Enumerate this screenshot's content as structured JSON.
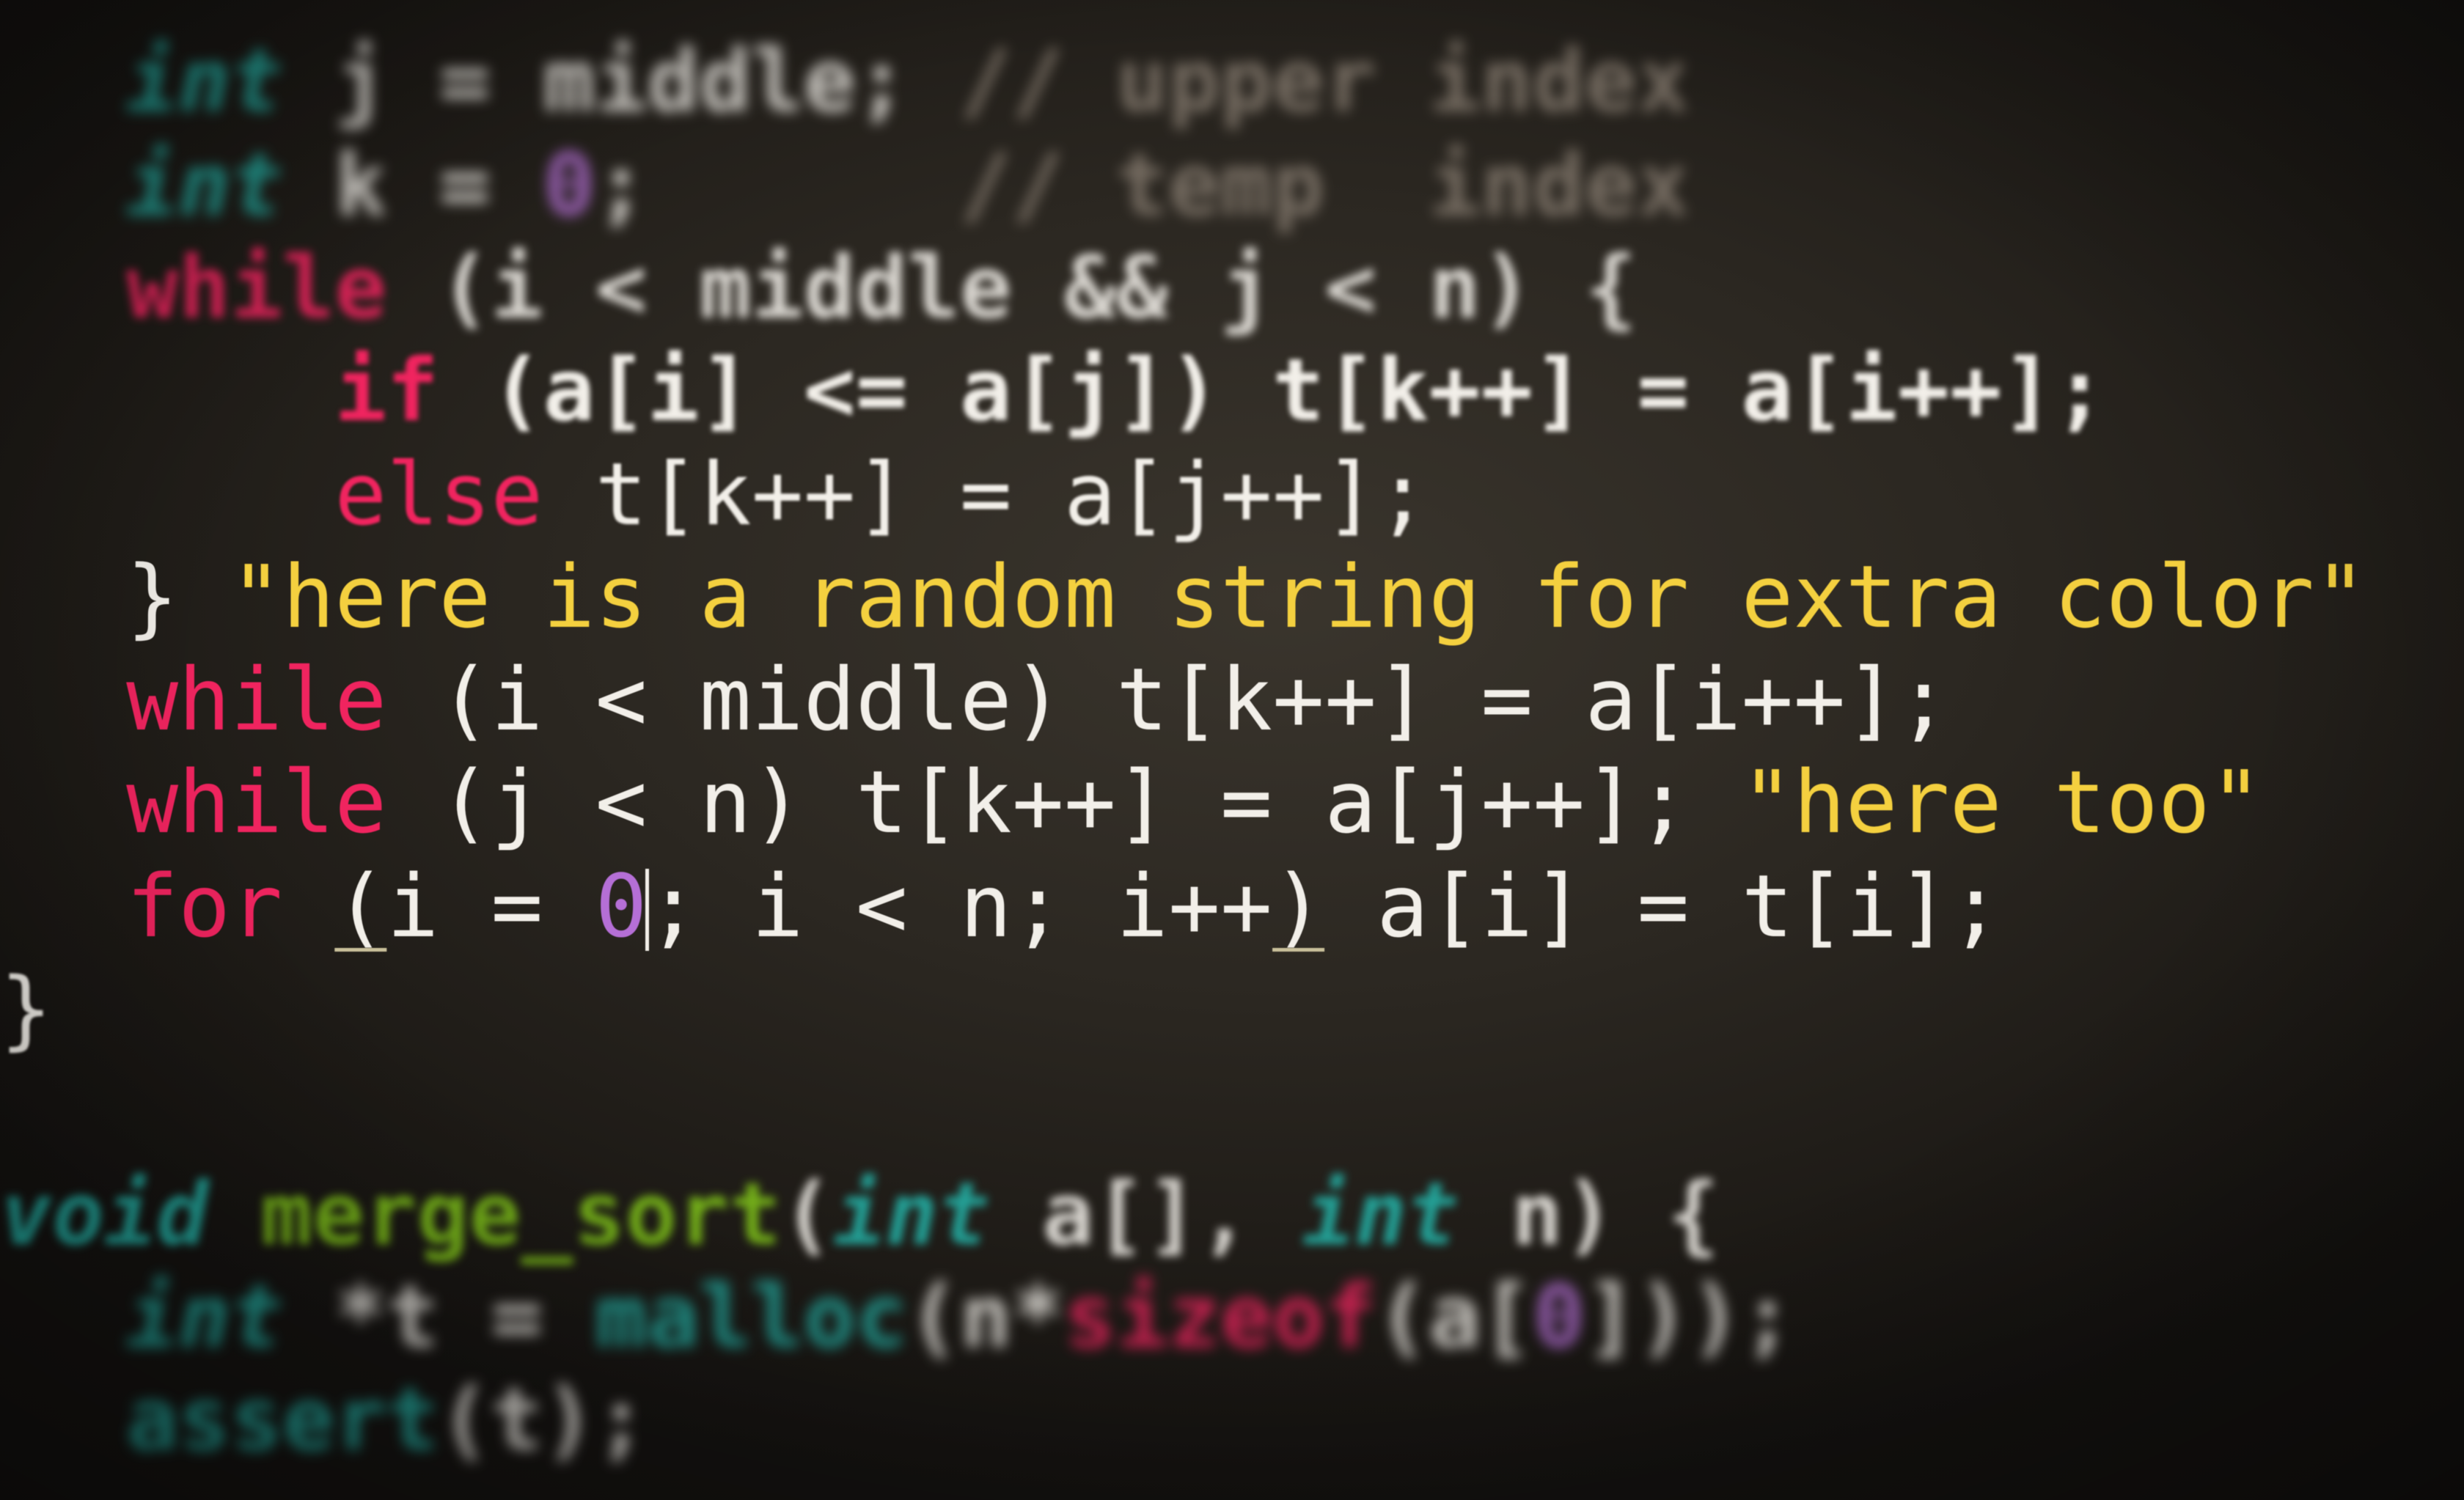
{
  "colors": {
    "background": "#2b2721",
    "keyword": "#f0245f",
    "type": "#24b3a8",
    "string": "#f4d03f",
    "number": "#b56fd6",
    "plain": "#f2efe9",
    "comment": "#8a7f73",
    "function": "#7fc21a",
    "cursor": "#f2efe9"
  },
  "code_lines": [
    {
      "tokens": [
        {
          "text": "  ",
          "color": "plain"
        },
        {
          "text": "int",
          "color": "type"
        },
        {
          "text": " j = middle; ",
          "color": "plain"
        },
        {
          "text": "// upper index",
          "color": "comment"
        }
      ]
    },
    {
      "tokens": [
        {
          "text": "  ",
          "color": "plain"
        },
        {
          "text": "int",
          "color": "type"
        },
        {
          "text": " k = ",
          "color": "plain"
        },
        {
          "text": "0",
          "color": "number"
        },
        {
          "text": ";      ",
          "color": "plain"
        },
        {
          "text": "// temp  index",
          "color": "comment"
        }
      ]
    },
    {
      "tokens": [
        {
          "text": "  ",
          "color": "plain"
        },
        {
          "text": "while",
          "color": "keyword"
        },
        {
          "text": " (i < middle && j < n) {",
          "color": "plain"
        }
      ]
    },
    {
      "tokens": [
        {
          "text": "      ",
          "color": "plain"
        },
        {
          "text": "if",
          "color": "keyword"
        },
        {
          "text": " (a[i] <= a[j]) t[k++] = a[i++];",
          "color": "plain"
        }
      ]
    },
    {
      "tokens": [
        {
          "text": "      ",
          "color": "plain"
        },
        {
          "text": "else",
          "color": "keyword"
        },
        {
          "text": " t[k++] = a[j++];",
          "color": "plain"
        }
      ]
    },
    {
      "tokens": [
        {
          "text": "  } ",
          "color": "plain"
        },
        {
          "text": "\"here is a random string for extra color\"",
          "color": "string"
        }
      ]
    },
    {
      "tokens": [
        {
          "text": "  ",
          "color": "plain"
        },
        {
          "text": "while",
          "color": "keyword"
        },
        {
          "text": " (i < middle) t[k++] = a[i++];",
          "color": "plain"
        }
      ]
    },
    {
      "tokens": [
        {
          "text": "  ",
          "color": "plain"
        },
        {
          "text": "while",
          "color": "keyword"
        },
        {
          "text": " (j < n) t[k++] = a[j++]; ",
          "color": "plain"
        },
        {
          "text": "\"here too\"",
          "color": "string"
        }
      ]
    },
    {
      "tokens": [
        {
          "text": "  ",
          "color": "plain"
        },
        {
          "text": "for",
          "color": "keyword"
        },
        {
          "text": " ",
          "color": "plain"
        },
        {
          "text": "(",
          "color": "plain",
          "underline": true
        },
        {
          "text": "i = ",
          "color": "plain"
        },
        {
          "text": "0",
          "color": "number"
        },
        {
          "text": "",
          "color": "plain",
          "cursor": true
        },
        {
          "text": "; i < n; i++",
          "color": "plain"
        },
        {
          "text": ")",
          "color": "plain",
          "underline": true
        },
        {
          "text": " a[i] = t[i];",
          "color": "plain"
        }
      ]
    },
    {
      "tokens": [
        {
          "text": "}",
          "color": "plain"
        }
      ]
    },
    {
      "tokens": []
    },
    {
      "tokens": [
        {
          "text": "void",
          "color": "type"
        },
        {
          "text": " ",
          "color": "plain"
        },
        {
          "text": "merge_sort",
          "color": "function"
        },
        {
          "text": "(",
          "color": "plain"
        },
        {
          "text": "int",
          "color": "type"
        },
        {
          "text": " a[], ",
          "color": "plain"
        },
        {
          "text": "int",
          "color": "type"
        },
        {
          "text": " n) {",
          "color": "plain"
        }
      ]
    },
    {
      "tokens": [
        {
          "text": "  ",
          "color": "plain"
        },
        {
          "text": "int",
          "color": "type"
        },
        {
          "text": " *t = ",
          "color": "plain"
        },
        {
          "text": "malloc",
          "color": "type"
        },
        {
          "text": "(n*",
          "color": "plain"
        },
        {
          "text": "sizeof",
          "color": "keyword"
        },
        {
          "text": "(a[",
          "color": "plain"
        },
        {
          "text": "0",
          "color": "number"
        },
        {
          "text": "]));",
          "color": "plain"
        }
      ]
    },
    {
      "tokens": [
        {
          "text": "  ",
          "color": "plain"
        },
        {
          "text": "assert",
          "color": "type"
        },
        {
          "text": "(t);",
          "color": "plain"
        }
      ]
    }
  ]
}
